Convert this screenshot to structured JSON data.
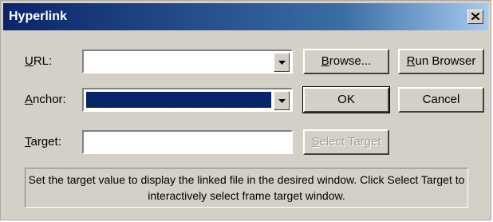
{
  "window": {
    "title": "Hyperlink"
  },
  "form": {
    "url_label": "URL:",
    "url_value": "",
    "anchor_label": "Anchor:",
    "anchor_value": "",
    "target_label": "Target:",
    "target_value": ""
  },
  "buttons": {
    "browse": "Browse...",
    "run_browser": "Run Browser",
    "ok": "OK",
    "cancel": "Cancel",
    "select_target": "Select Target"
  },
  "help_text": "Set the target value to display the linked file in the desired window. Click Select Target to interactively select frame target window.",
  "colors": {
    "title_start": "#0a246a",
    "title_end": "#a6caf0",
    "face": "#d4d0c8",
    "selection": "#0a246a"
  }
}
